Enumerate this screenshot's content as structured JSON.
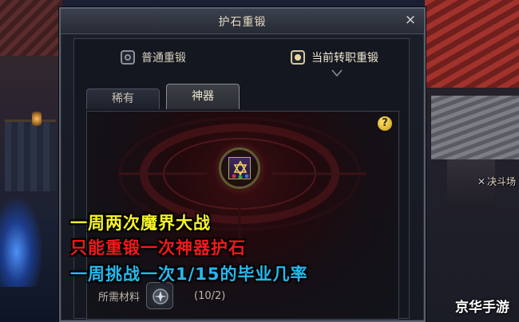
{
  "background": {
    "duel_sign": "决斗场"
  },
  "dialog": {
    "title": "护石重锻",
    "close_glyph": "×",
    "modes": [
      {
        "label": "普通重锻",
        "selected": false
      },
      {
        "label": "当前转职重锻",
        "selected": true
      }
    ],
    "tabs": [
      {
        "label": "稀有",
        "active": false
      },
      {
        "label": "神器",
        "active": true
      }
    ],
    "help_glyph": "?",
    "material": {
      "label": "所需材料",
      "count": "(10/2)"
    }
  },
  "captions": [
    "一周两次魔界大战",
    "只能重锻一次神器护石",
    "一周挑战一次1/15的毕业几率"
  ],
  "watermark": "京华手游",
  "colors": {
    "caption_yellow": "#f5f22a",
    "caption_red": "#f21a1a",
    "caption_blue": "#25b9ee",
    "title_text": "#e4d9c2",
    "help_yellow": "#ffe36b"
  }
}
